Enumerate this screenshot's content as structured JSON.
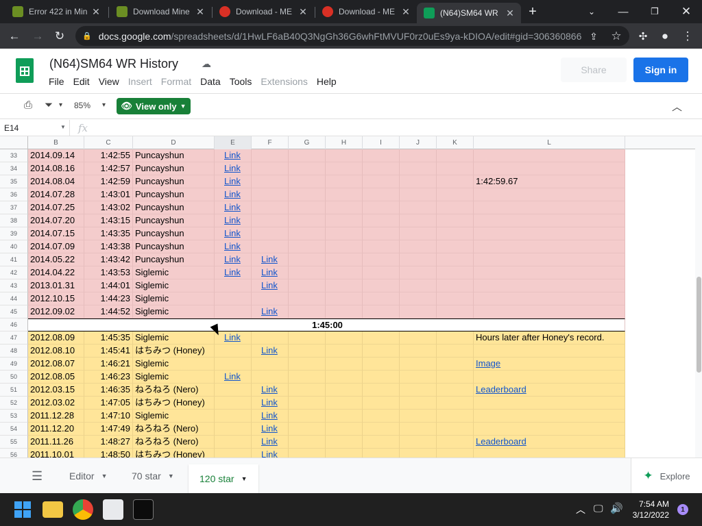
{
  "browser": {
    "tabs": [
      {
        "title": "Error 422 in Min",
        "active": false
      },
      {
        "title": "Download Mine",
        "active": false
      },
      {
        "title": "Download - ME",
        "active": false
      },
      {
        "title": "Download - ME",
        "active": false
      },
      {
        "title": "(N64)SM64 WR",
        "active": true
      }
    ],
    "new_tab": "+",
    "url_host": "docs.google.com",
    "url_path": "/spreadsheets/d/1HwLF6aB40Q3NgGh36G6whFtMVUF0rz0uEs9ya-kDIOA/edit#gid=306360866"
  },
  "sheets": {
    "title": "(N64)SM64 WR History",
    "menu": [
      {
        "label": "File",
        "disabled": false
      },
      {
        "label": "Edit",
        "disabled": false
      },
      {
        "label": "View",
        "disabled": false
      },
      {
        "label": "Insert",
        "disabled": true
      },
      {
        "label": "Format",
        "disabled": true
      },
      {
        "label": "Data",
        "disabled": false
      },
      {
        "label": "Tools",
        "disabled": false
      },
      {
        "label": "Extensions",
        "disabled": true
      },
      {
        "label": "Help",
        "disabled": false
      }
    ],
    "share_label": "Share",
    "signin_label": "Sign in",
    "zoom": "85%",
    "view_only_label": "View only",
    "name_box": "E14",
    "fx": "fx",
    "columns": [
      "B",
      "C",
      "D",
      "E",
      "F",
      "G",
      "H",
      "I",
      "J",
      "K",
      "L"
    ],
    "rows": [
      {
        "n": "33",
        "band": "pink",
        "b": "2014.09.14",
        "c": "1:42:55",
        "d": "Puncayshun",
        "e": "Link",
        "f": "",
        "l": "",
        "l_link": false
      },
      {
        "n": "34",
        "band": "pink",
        "b": "2014.08.16",
        "c": "1:42:57",
        "d": "Puncayshun",
        "e": "Link",
        "f": "",
        "l": "",
        "l_link": false
      },
      {
        "n": "35",
        "band": "pink",
        "b": "2014.08.04",
        "c": "1:42:59",
        "d": "Puncayshun",
        "e": "Link",
        "f": "",
        "l": "1:42:59.67",
        "l_link": false
      },
      {
        "n": "36",
        "band": "pink",
        "b": "2014.07.28",
        "c": "1:43:01",
        "d": "Puncayshun",
        "e": "Link",
        "f": "",
        "l": "",
        "l_link": false
      },
      {
        "n": "37",
        "band": "pink",
        "b": "2014.07.25",
        "c": "1:43:02",
        "d": "Puncayshun",
        "e": "Link",
        "f": "",
        "l": "",
        "l_link": false
      },
      {
        "n": "38",
        "band": "pink",
        "b": "2014.07.20",
        "c": "1:43:15",
        "d": "Puncayshun",
        "e": "Link",
        "f": "",
        "l": "",
        "l_link": false
      },
      {
        "n": "39",
        "band": "pink",
        "b": "2014.07.15",
        "c": "1:43:35",
        "d": "Puncayshun",
        "e": "Link",
        "f": "",
        "l": "",
        "l_link": false
      },
      {
        "n": "40",
        "band": "pink",
        "b": "2014.07.09",
        "c": "1:43:38",
        "d": "Puncayshun",
        "e": "Link",
        "f": "",
        "l": "",
        "l_link": false
      },
      {
        "n": "41",
        "band": "pink",
        "b": "2014.05.22",
        "c": "1:43:42",
        "d": "Puncayshun",
        "e": "Link",
        "f": "Link",
        "l": "",
        "l_link": false
      },
      {
        "n": "42",
        "band": "pink",
        "b": "2014.04.22",
        "c": "1:43:53",
        "d": "Siglemic",
        "e": "Link",
        "f": "Link",
        "l": "",
        "l_link": false
      },
      {
        "n": "43",
        "band": "pink",
        "b": "2013.01.31",
        "c": "1:44:01",
        "d": "Siglemic",
        "e": "",
        "f": "Link",
        "l": "",
        "l_link": false
      },
      {
        "n": "44",
        "band": "pink",
        "b": "2012.10.15",
        "c": "1:44:23",
        "d": "Siglemic",
        "e": "",
        "f": "",
        "l": "",
        "l_link": false
      },
      {
        "n": "45",
        "band": "pink",
        "b": "2012.09.02",
        "c": "1:44:52",
        "d": "Siglemic",
        "e": "",
        "f": "Link",
        "l": "",
        "l_link": false
      },
      {
        "n": "46",
        "band": "sep",
        "label": "1:45:00"
      },
      {
        "n": "47",
        "band": "yellow",
        "b": "2012.08.09",
        "c": "1:45:35",
        "d": "Siglemic",
        "e": "Link",
        "f": "",
        "l": "Hours later after Honey's record.",
        "l_link": false
      },
      {
        "n": "48",
        "band": "yellow",
        "b": "2012.08.10",
        "c": "1:45:41",
        "d": "はちみつ (Honey)",
        "e": "",
        "f": "Link",
        "l": "",
        "l_link": false
      },
      {
        "n": "49",
        "band": "yellow",
        "b": "2012.08.07",
        "c": "1:46:21",
        "d": "Siglemic",
        "e": "",
        "f": "",
        "l": "Image",
        "l_link": true
      },
      {
        "n": "50",
        "band": "yellow",
        "b": "2012.08.05",
        "c": "1:46:23",
        "d": "Siglemic",
        "e": "Link",
        "f": "",
        "l": "",
        "l_link": false
      },
      {
        "n": "51",
        "band": "yellow",
        "b": "2012.03.15",
        "c": "1:46:35",
        "d": "ねろねろ (Nero)",
        "e": "",
        "f": "Link",
        "l": "Leaderboard",
        "l_link": true
      },
      {
        "n": "52",
        "band": "yellow",
        "b": "2012.03.02",
        "c": "1:47:05",
        "d": "はちみつ (Honey)",
        "e": "",
        "f": "Link",
        "l": "",
        "l_link": false
      },
      {
        "n": "53",
        "band": "yellow",
        "b": "2011.12.28",
        "c": "1:47:10",
        "d": "Siglemic",
        "e": "",
        "f": "Link",
        "l": "",
        "l_link": false
      },
      {
        "n": "54",
        "band": "yellow",
        "b": "2011.12.20",
        "c": "1:47:49",
        "d": "ねろねろ (Nero)",
        "e": "",
        "f": "Link",
        "l": "",
        "l_link": false
      },
      {
        "n": "55",
        "band": "yellow",
        "b": "2011.11.26",
        "c": "1:48:27",
        "d": "ねろねろ (Nero)",
        "e": "",
        "f": "Link",
        "l": "Leaderboard",
        "l_link": true
      },
      {
        "n": "56",
        "band": "yellow",
        "b": "2011.10.01",
        "c": "1:48:50",
        "d": "はちみつ (Honey)",
        "e": "",
        "f": "Link",
        "l": "",
        "l_link": false
      }
    ],
    "sheet_tabs": [
      {
        "label": "Editor",
        "active": false
      },
      {
        "label": "70 star",
        "active": false
      },
      {
        "label": "120 star",
        "active": true
      }
    ],
    "explore_label": "Explore"
  },
  "taskbar": {
    "time": "7:54 AM",
    "date": "3/12/2022",
    "notifications": "1"
  },
  "colors": {
    "pink_band": "#f4cccc",
    "yellow_band": "#ffe599",
    "link": "#1155cc",
    "sheets_green": "#188038",
    "signin_blue": "#1a73e8"
  }
}
